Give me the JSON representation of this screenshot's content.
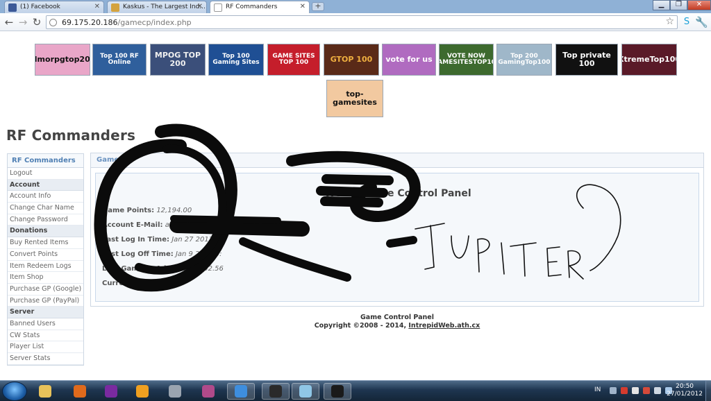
{
  "browser": {
    "tabs": [
      {
        "title": "(1) Facebook",
        "icon": "facebook-icon",
        "color": "#3b5998"
      },
      {
        "title": "Kaskus - The Largest Ind...",
        "icon": "kaskus-icon",
        "color": "#d4a33f"
      },
      {
        "title": "RF Commanders",
        "icon": "page-icon",
        "color": "#ffffff"
      }
    ],
    "new_tab_label": "+",
    "url_host": "69.175.20.186",
    "url_path": "/gamecp/index.php"
  },
  "banners": [
    {
      "label": "Mmorpgtop200",
      "bg": "#e9a6c8",
      "fg": "#111111"
    },
    {
      "label": "Top 100 RF Online",
      "bg": "#2f5f9c",
      "fg": "#ffffff"
    },
    {
      "label": "MPOG TOP 200",
      "bg": "#3b4f7a",
      "fg": "#f0f0f0"
    },
    {
      "label": "Top 100 Gaming Sites",
      "bg": "#1f4f94",
      "fg": "#ffffff"
    },
    {
      "label": "GAME SITES TOP 100",
      "bg": "#c51e2b",
      "fg": "#ffffff"
    },
    {
      "label": "GTOP 100",
      "bg": "#5a2a18",
      "fg": "#f0b040"
    },
    {
      "label": "vote for us",
      "bg": "#b06bc0",
      "fg": "#ffffff"
    },
    {
      "label": "VOTE NOW GAMESITESTOP100",
      "bg": "#3d6a2e",
      "fg": "#ffffff"
    },
    {
      "label": "Top 200 GamingTop100",
      "bg": "#9fb7c9",
      "fg": "#ffffff"
    },
    {
      "label": "Top private 100",
      "bg": "#111111",
      "fg": "#ffffff"
    },
    {
      "label": "XtremeTop100",
      "bg": "#5a1a28",
      "fg": "#ffffff"
    },
    {
      "label": "top-gamesites",
      "bg": "#f2c9a0",
      "fg": "#111111"
    }
  ],
  "site_title": "RF Commanders",
  "sidebar": {
    "header": "RF Commanders",
    "items": [
      {
        "label": "Logout",
        "type": "link"
      },
      {
        "label": "Account",
        "type": "group"
      },
      {
        "label": "Account Info",
        "type": "link"
      },
      {
        "label": "Change Char Name",
        "type": "link"
      },
      {
        "label": "Change Password",
        "type": "link"
      },
      {
        "label": "Donations",
        "type": "group"
      },
      {
        "label": "Buy Rented Items",
        "type": "link"
      },
      {
        "label": "Convert Points",
        "type": "link"
      },
      {
        "label": "Item Redeem Logs",
        "type": "link"
      },
      {
        "label": "Item Shop",
        "type": "link"
      },
      {
        "label": "Purchase GP (Google)",
        "type": "link"
      },
      {
        "label": "Purchase GP (PayPal)",
        "type": "link"
      },
      {
        "label": "Server",
        "type": "group"
      },
      {
        "label": "Banned Users",
        "type": "link"
      },
      {
        "label": "CW Stats",
        "type": "link"
      },
      {
        "label": "Player List",
        "type": "link"
      },
      {
        "label": "Server Stats",
        "type": "link"
      }
    ]
  },
  "panel": {
    "tab_label": "Game",
    "welcome": "Welcom                    ame Control Panel",
    "rows": [
      {
        "label": "Game Points:",
        "value": "12,194.00"
      },
      {
        "label": "Account E-Mail:",
        "value": "a"
      },
      {
        "label": "Last Log In Time:",
        "value": "Jan 27 2012 5:3"
      },
      {
        "label": "Last Log Off Time:",
        "value": "Jan 9 2012 9:"
      },
      {
        "label": "Last Game IP Address:",
        "value": "30   02.56"
      },
      {
        "label": "Current State:",
        "value": "O"
      }
    ]
  },
  "handwriting": "JUPITER",
  "footer": {
    "line1": "Game Control Panel",
    "line2_prefix": "Copyright ©2008 - 2014, ",
    "line2_link": "IntrepidWeb.ath.cx"
  },
  "taskbar": {
    "apps": [
      {
        "icon": "explorer-icon",
        "color": "#e8c25a"
      },
      {
        "icon": "media-player-icon",
        "color": "#e06a1c"
      },
      {
        "icon": "yahoo-messenger-icon",
        "color": "#7a2aa0"
      },
      {
        "icon": "media-center-icon",
        "color": "#f0a020"
      },
      {
        "icon": "pen-tool-icon",
        "color": "#9aa4b0"
      },
      {
        "icon": "winrar-icon",
        "color": "#b04a8a"
      },
      {
        "icon": "chrome-icon",
        "color": "#3e8ede"
      },
      {
        "icon": "game-launcher-icon",
        "color": "#2a2a2a"
      },
      {
        "icon": "notes-icon",
        "color": "#8fc6e6"
      },
      {
        "icon": "game-client-icon",
        "color": "#1a1a1a"
      }
    ],
    "language": "IN",
    "time": "20:50",
    "date": "27/01/2012"
  }
}
